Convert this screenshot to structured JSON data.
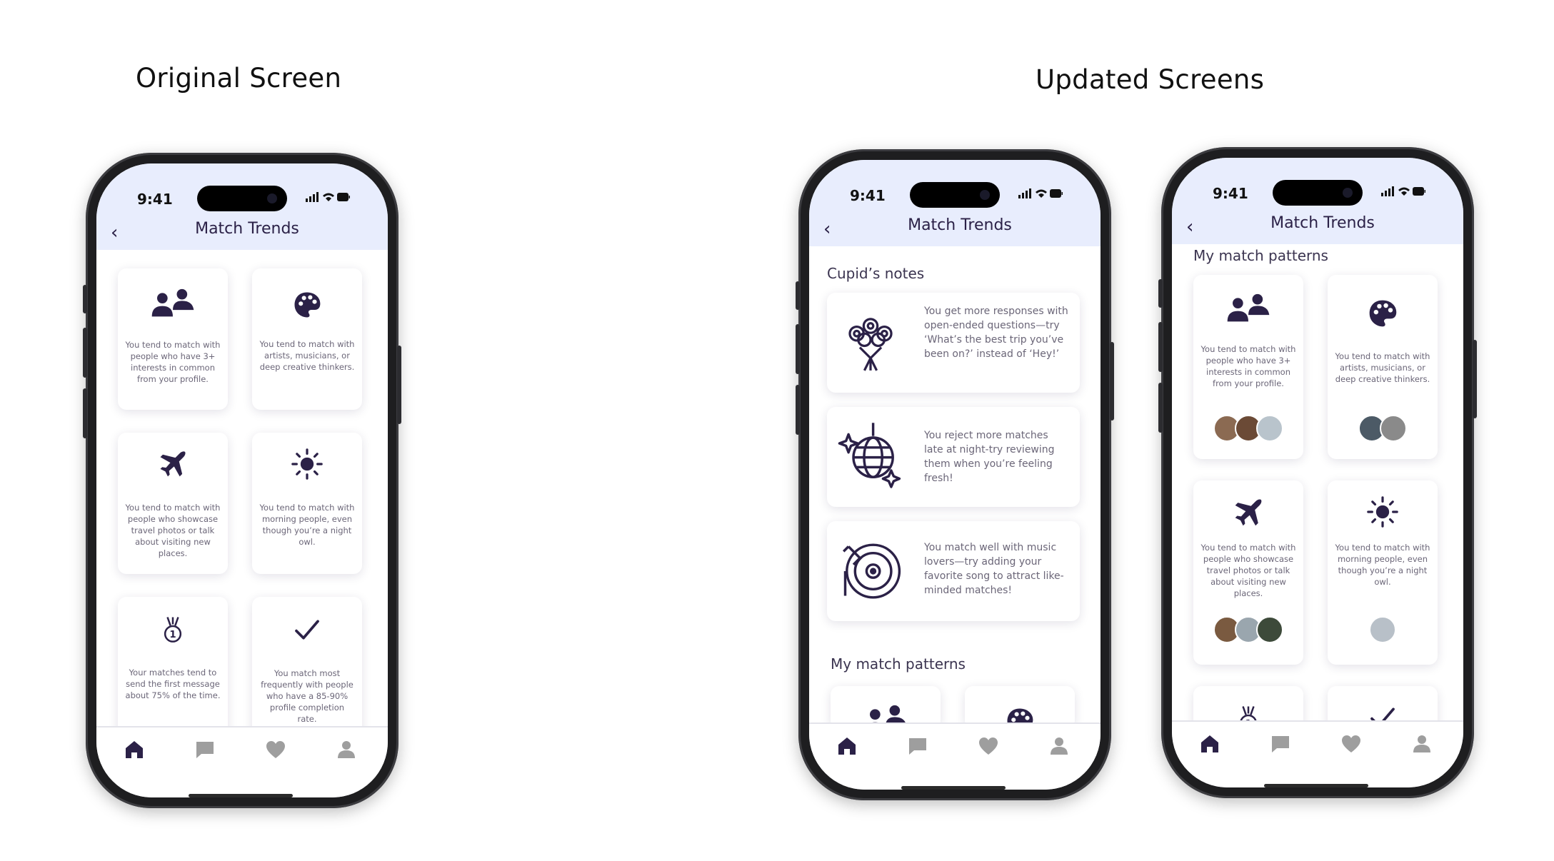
{
  "headings": {
    "original": "Original Screen",
    "updated": "Updated Screens"
  },
  "status_time": "9:41",
  "screen_title": "Match Trends",
  "tabs": [
    "home-icon",
    "chat-icon",
    "heart-icon",
    "profile-icon"
  ],
  "colors": {
    "header_bg": "#e8edfd",
    "accent": "#2b2147",
    "text_muted": "#6b6678",
    "tab_inactive": "#9e9e9e"
  },
  "pattern_cards": [
    {
      "icon": "people-icon",
      "text": "You tend to match with people who have 3+ interests in common from your profile."
    },
    {
      "icon": "palette-icon",
      "text": "You tend to match with artists, musicians, or deep creative thinkers."
    },
    {
      "icon": "airplane-icon",
      "text": "You tend to match with people who showcase travel photos or talk about visiting new places."
    },
    {
      "icon": "sun-icon",
      "text": "You tend to match with morning people, even though you’re a night owl."
    },
    {
      "icon": "medal-icon",
      "text": "Your matches tend to send the first message about 75% of the time."
    },
    {
      "icon": "check-icon",
      "text": "You match most frequently with people who have a 85-90% profile completion rate."
    }
  ],
  "cupids_notes": {
    "heading": "Cupid’s notes",
    "notes": [
      {
        "icon": "bouquet-icon",
        "text": "You get more responses with open-ended questions—try ‘What’s the best trip you’ve been on?’ instead of ‘Hey!’"
      },
      {
        "icon": "disco-ball-icon",
        "text": "You reject more matches late at night-try reviewing them when you’re feeling fresh!"
      },
      {
        "icon": "vinyl-record-icon",
        "text": "You match well with music lovers—try adding your favorite song to attract like-minded matches!"
      }
    ]
  },
  "my_match_patterns": "My match patterns"
}
